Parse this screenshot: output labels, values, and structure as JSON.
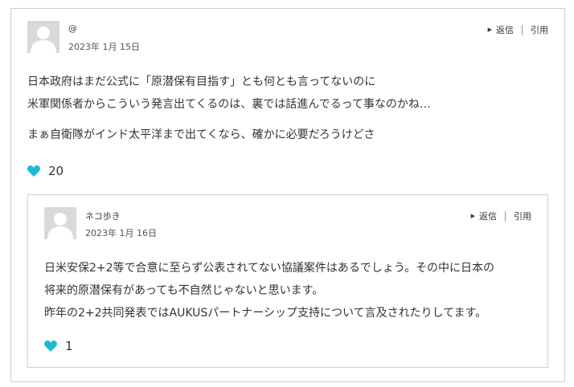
{
  "comment": {
    "author": "@",
    "date": "2023年 1月 15日",
    "reply_label": "返信",
    "quote_label": "引用",
    "paragraphs": [
      [
        "日本政府はまだ公式に「原潜保有目指す」とも何とも言ってないのに",
        "米軍関係者からこういう発言出てくるのは、裏では話進んでるって事なのかね…"
      ],
      [
        "まぁ自衛隊がインド太平洋まで出てくなら、確かに必要だろうけどさ"
      ]
    ],
    "likes": "20",
    "reply": {
      "author": "ネコ歩き",
      "date": "2023年 1月 16日",
      "reply_label": "返信",
      "quote_label": "引用",
      "lines": [
        "日米安保2+2等で合意に至らず公表されてない協議案件はあるでしょう。その中に日本の",
        "将来的原潜保有があっても不自然じゃないと思います。",
        "昨年の2+2共同発表ではAUKUSパートナーシップ支持について言及されたりしてます。"
      ],
      "likes": "1"
    }
  },
  "colors": {
    "heart": "#1bbbd3",
    "border": "#cfcfcf",
    "avatar_bg": "#d9d9d9"
  }
}
